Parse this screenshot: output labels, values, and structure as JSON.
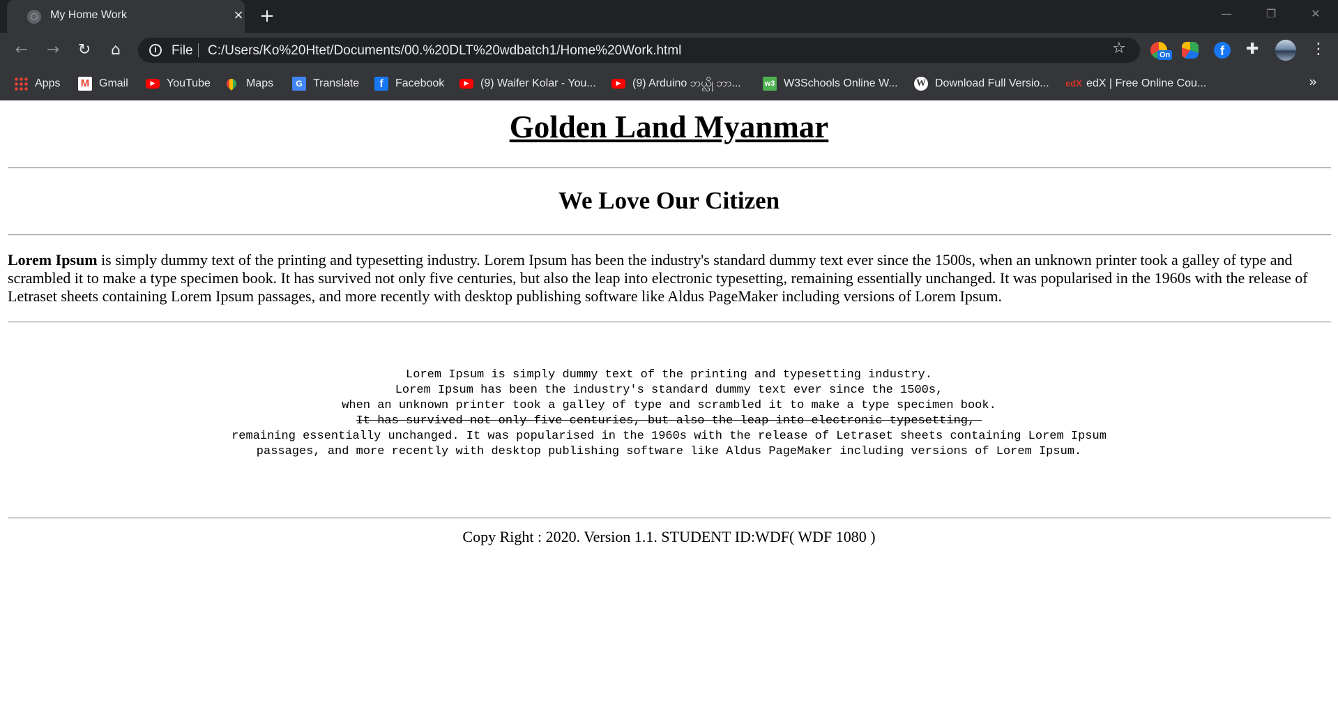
{
  "browser": {
    "tab": {
      "title": "My Home Work",
      "close_glyph": "×"
    },
    "new_tab_glyph": "+",
    "window_controls": {
      "minimize": "—",
      "maximize": "❐",
      "close": "✕"
    },
    "nav": {
      "back": "←",
      "forward": "→",
      "reload": "↻",
      "home": "⌂"
    },
    "omnibox": {
      "scheme": "File",
      "url": "C:/Users/Ko%20Htet/Documents/00.%20DLT%20wdbatch1/Home%20Work.html"
    },
    "extensions": [
      {
        "name": "on-extension-icon",
        "badge": "On"
      },
      {
        "name": "colorful-extension-icon"
      },
      {
        "name": "facebook-extension-icon"
      }
    ],
    "more_bookmarks_glyph": "»",
    "bookmarks": [
      {
        "label": "Apps",
        "icon": "apps-grid-icon"
      },
      {
        "label": "Gmail",
        "icon": "gmail-icon"
      },
      {
        "label": "YouTube",
        "icon": "youtube-icon"
      },
      {
        "label": "Maps",
        "icon": "maps-pin-icon"
      },
      {
        "label": "Translate",
        "icon": "translate-icon"
      },
      {
        "label": "Facebook",
        "icon": "facebook-icon"
      },
      {
        "label": "(9) Waifer Kolar - You...",
        "icon": "youtube-icon"
      },
      {
        "label": "(9) Arduino ဘယ္လို ဘာ...",
        "icon": "youtube-icon"
      },
      {
        "label": "W3Schools Online W...",
        "icon": "w3schools-icon"
      },
      {
        "label": "Download Full Versio...",
        "icon": "wordpress-icon"
      },
      {
        "label": "edX | Free Online Cou...",
        "icon": "edx-icon"
      }
    ],
    "colors": {
      "chrome_dark": "#202124",
      "chrome": "#35363a",
      "text": "#e8eaed"
    }
  },
  "page": {
    "title": "Golden Land Myanmar",
    "subtitle": "We Love Our Citizen",
    "paragraph": {
      "bold_lead": "Lorem Ipsum",
      "rest": " is simply dummy text of the printing and typesetting industry. Lorem Ipsum has been the industry's standard dummy text ever since the 1500s, when an unknown printer took a galley of type and scrambled it to make a type specimen book. It has survived not only five centuries, but also the leap into electronic typesetting, remaining essentially unchanged. It was popularised in the 1960s with the release of Letraset sheets containing Lorem Ipsum passages, and more recently with desktop publishing software like Aldus PageMaker including versions of Lorem Ipsum."
    },
    "preformatted": {
      "line1": "Lorem Ipsum is simply dummy text of the printing and typesetting industry.",
      "line2": "Lorem Ipsum has been the industry's standard dummy text ever since the 1500s,",
      "line3": "when an unknown printer took a galley of type and scrambled it to make a type specimen book.",
      "line4_struck": "It has survived not only five centuries, but also the leap into electronic typesetting, ",
      "line5": "remaining essentially unchanged. It was popularised in the 1960s with the release of Letraset sheets containing Lorem Ipsum",
      "line6": "passages, and more recently with desktop publishing software like Aldus PageMaker including versions of Lorem Ipsum."
    },
    "footer": "Copy Right : 2020. Version 1.1. STUDENT ID:WDF( WDF 1080 )"
  }
}
